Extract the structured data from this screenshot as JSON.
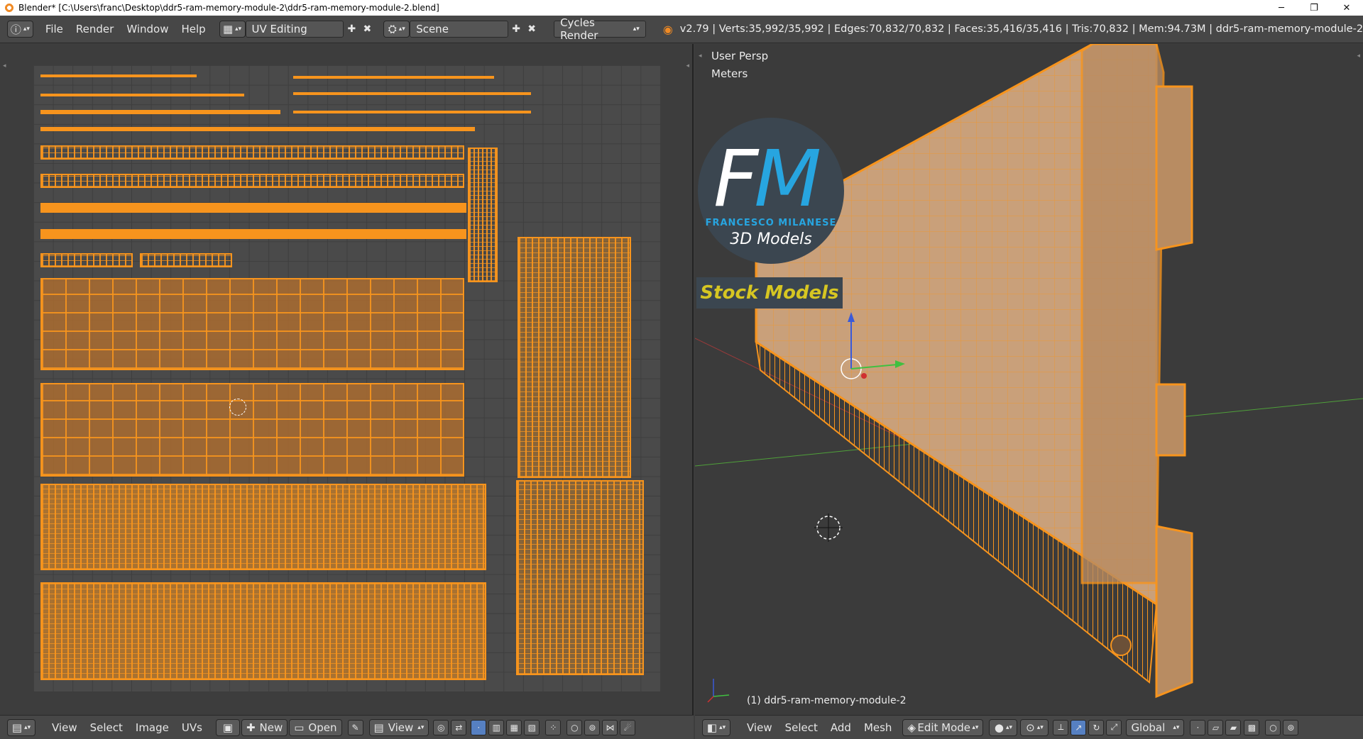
{
  "window": {
    "title": "Blender* [C:\\Users\\franc\\Desktop\\ddr5-ram-memory-module-2\\ddr5-ram-memory-module-2.blend]",
    "minimize": "─",
    "restore": "❐",
    "close": "✕"
  },
  "info_header": {
    "menus": [
      "File",
      "Render",
      "Window",
      "Help"
    ],
    "screen_layout": "UV Editing",
    "scene": "Scene",
    "render_engine": "Cycles Render",
    "stats": "v2.79 | Verts:35,992/35,992 | Edges:70,832/70,832 | Faces:35,416/35,416 | Tris:70,832 | Mem:94.73M | ddr5-ram-memory-module-2"
  },
  "uv_editor": {
    "menus": [
      "View",
      "Select",
      "Image",
      "UVs"
    ],
    "new_label": "New",
    "open_label": "Open",
    "view_label": "View"
  },
  "viewport": {
    "view_name": "User Persp",
    "units": "Meters",
    "object_label": "(1) ddr5-ram-memory-module-2",
    "menus": [
      "View",
      "Select",
      "Add",
      "Mesh"
    ],
    "mode": "Edit Mode",
    "orientation": "Global",
    "watermark": {
      "letter_f": "F",
      "letter_m": "M",
      "brand": "FRANCESCO MILANESE",
      "subtitle": "3D Models",
      "banner": "Stock Models"
    }
  },
  "colors": {
    "uv_edge": "#f7941d",
    "face_fill": "#aa6c30",
    "logo_blue": "#27a5e0",
    "logo_bg": "#3b4650",
    "banner_text": "#d6c622",
    "active_button": "#5680c2"
  }
}
